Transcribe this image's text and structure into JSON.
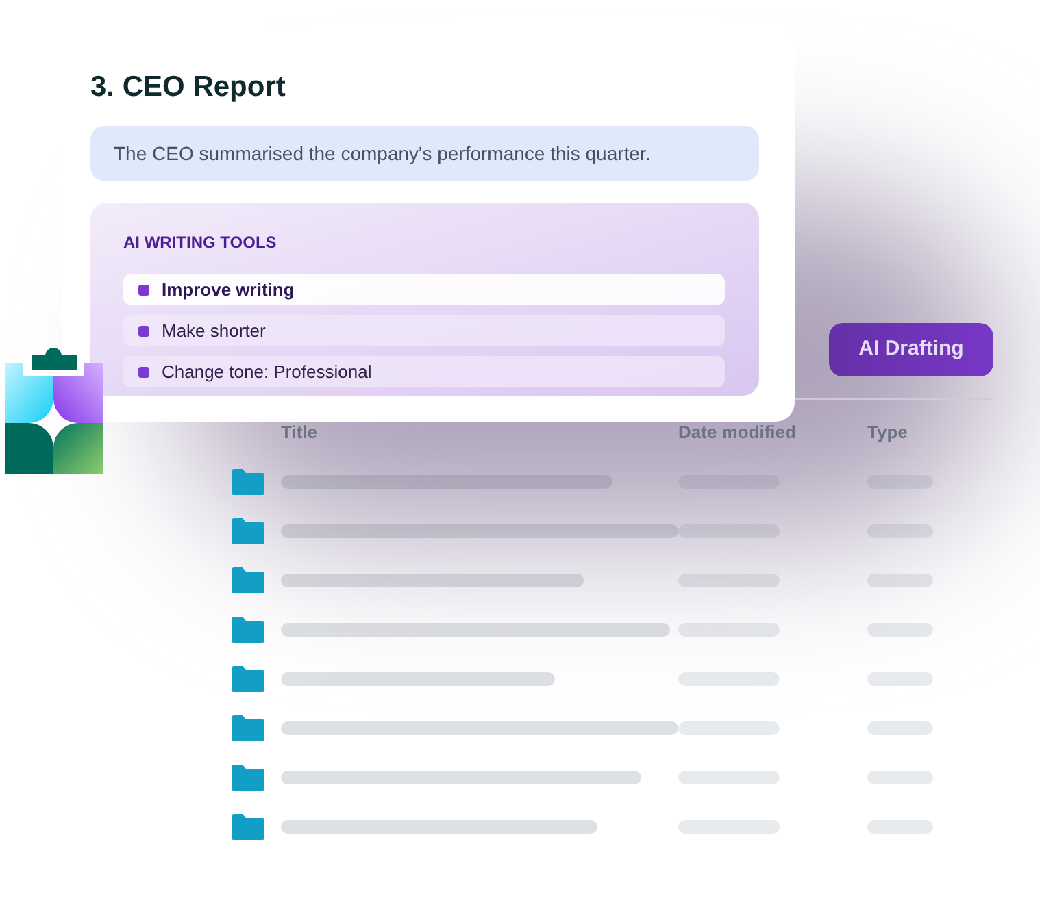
{
  "report_card": {
    "title": "3. CEO Report",
    "sentence": "The CEO summarised the company's performance this quarter.",
    "tools": {
      "heading": "AI WRITING TOOLS",
      "options": [
        {
          "label": "Improve writing",
          "selected": true
        },
        {
          "label": "Make shorter",
          "selected": false
        },
        {
          "label": "Change tone: Professional",
          "selected": false
        }
      ]
    }
  },
  "file_list": {
    "button": "AI Drafting",
    "columns": [
      "Title",
      "Date modified",
      "Type"
    ],
    "rows": [
      {
        "kind": "folder"
      },
      {
        "kind": "folder"
      },
      {
        "kind": "folder"
      },
      {
        "kind": "folder"
      },
      {
        "kind": "folder"
      },
      {
        "kind": "folder"
      },
      {
        "kind": "folder"
      },
      {
        "kind": "folder"
      }
    ]
  }
}
